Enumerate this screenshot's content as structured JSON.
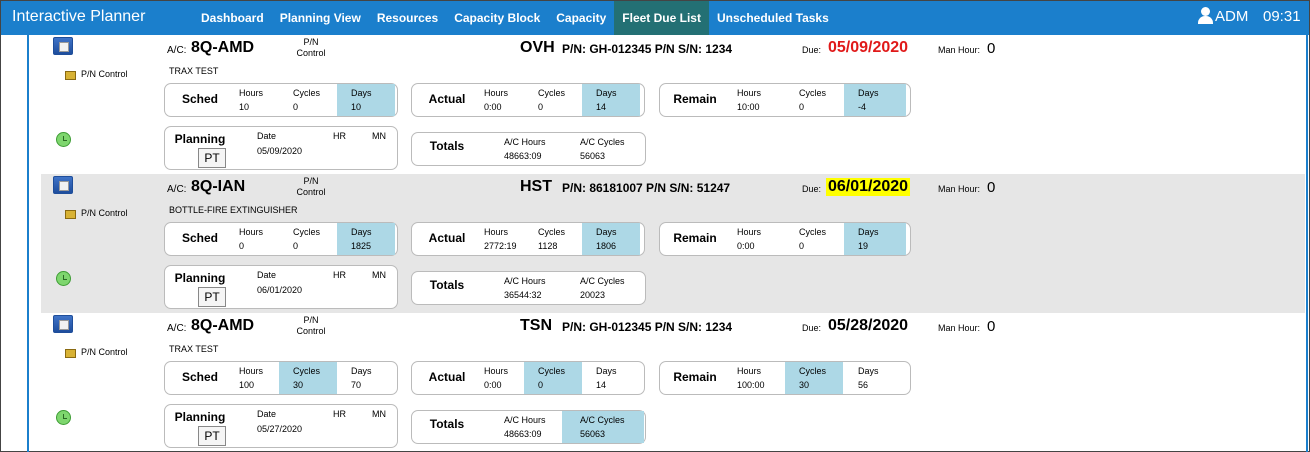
{
  "app": {
    "title": "Interactive Planner",
    "user": "ADM",
    "time": "09:31"
  },
  "nav": [
    {
      "label": "Dashboard",
      "active": false
    },
    {
      "label": "Planning View",
      "active": false
    },
    {
      "label": "Resources",
      "active": false
    },
    {
      "label": "Capacity Block",
      "active": false
    },
    {
      "label": "Capacity",
      "active": false
    },
    {
      "label": "Fleet Due List",
      "active": true
    },
    {
      "label": "Unscheduled Tasks",
      "active": false
    }
  ],
  "labels": {
    "ac": "A/C:",
    "pn_control_top": "P/N",
    "pn_control_bottom": "Control",
    "pn_control": "P/N Control",
    "due": "Due:",
    "man_hour": "Man Hour:",
    "sched": "Sched",
    "actual": "Actual",
    "remain": "Remain",
    "planning": "Planning",
    "totals": "Totals",
    "hours": "Hours",
    "cycles": "Cycles",
    "days": "Days",
    "date": "Date",
    "hr": "HR",
    "mn": "MN",
    "pt": "PT",
    "ac_hours": "A/C Hours",
    "ac_cycles": "A/C Cycles"
  },
  "colors": {
    "nav": "#1b7fcc",
    "active_tab": "#237074",
    "highlight": "#add8e6",
    "overdue": "#e01919",
    "due_soon": "#ffff00",
    "alt_row": "#e6e6e6"
  },
  "records": [
    {
      "ac": "8Q-AMD",
      "desc": "TRAX TEST",
      "type": "OVH",
      "pnsn": "P/N: GH-012345 P/N S/N: 1234",
      "due": "05/09/2020",
      "due_style": "red",
      "man_hour": "0",
      "alt": false,
      "sched": {
        "hours": "10",
        "cycles": "0",
        "days": "10",
        "hl": "days"
      },
      "actual": {
        "hours": "0:00",
        "cycles": "0",
        "days": "14",
        "hl": "days"
      },
      "remain": {
        "hours": "10:00",
        "cycles": "0",
        "days": "-4",
        "hl": "days"
      },
      "planning": {
        "date": "05/09/2020"
      },
      "totals": {
        "ac_hours": "48663:09",
        "ac_cycles": "56063",
        "hl": ""
      }
    },
    {
      "ac": "8Q-IAN",
      "desc": "BOTTLE-FIRE EXTINGUISHER",
      "type": "HST",
      "pnsn": "P/N: 86181007 P/N S/N: 51247",
      "due": "06/01/2020",
      "due_style": "yellow",
      "man_hour": "0",
      "alt": true,
      "sched": {
        "hours": "0",
        "cycles": "0",
        "days": "1825",
        "hl": "days"
      },
      "actual": {
        "hours": "2772:19",
        "cycles": "1128",
        "days": "1806",
        "hl": "days"
      },
      "remain": {
        "hours": "0:00",
        "cycles": "0",
        "days": "19",
        "hl": "days"
      },
      "planning": {
        "date": "06/01/2020"
      },
      "totals": {
        "ac_hours": "36544:32",
        "ac_cycles": "20023",
        "hl": ""
      }
    },
    {
      "ac": "8Q-AMD",
      "desc": "TRAX TEST",
      "type": "TSN",
      "pnsn": "P/N: GH-012345 P/N S/N: 1234",
      "due": "05/28/2020",
      "due_style": "none",
      "man_hour": "0",
      "alt": false,
      "sched": {
        "hours": "100",
        "cycles": "30",
        "days": "70",
        "hl": "cycles"
      },
      "actual": {
        "hours": "0:00",
        "cycles": "0",
        "days": "14",
        "hl": "cycles"
      },
      "remain": {
        "hours": "100:00",
        "cycles": "30",
        "days": "56",
        "hl": "cycles"
      },
      "planning": {
        "date": "05/27/2020"
      },
      "totals": {
        "ac_hours": "48663:09",
        "ac_cycles": "56063",
        "hl": "cycles"
      }
    }
  ]
}
